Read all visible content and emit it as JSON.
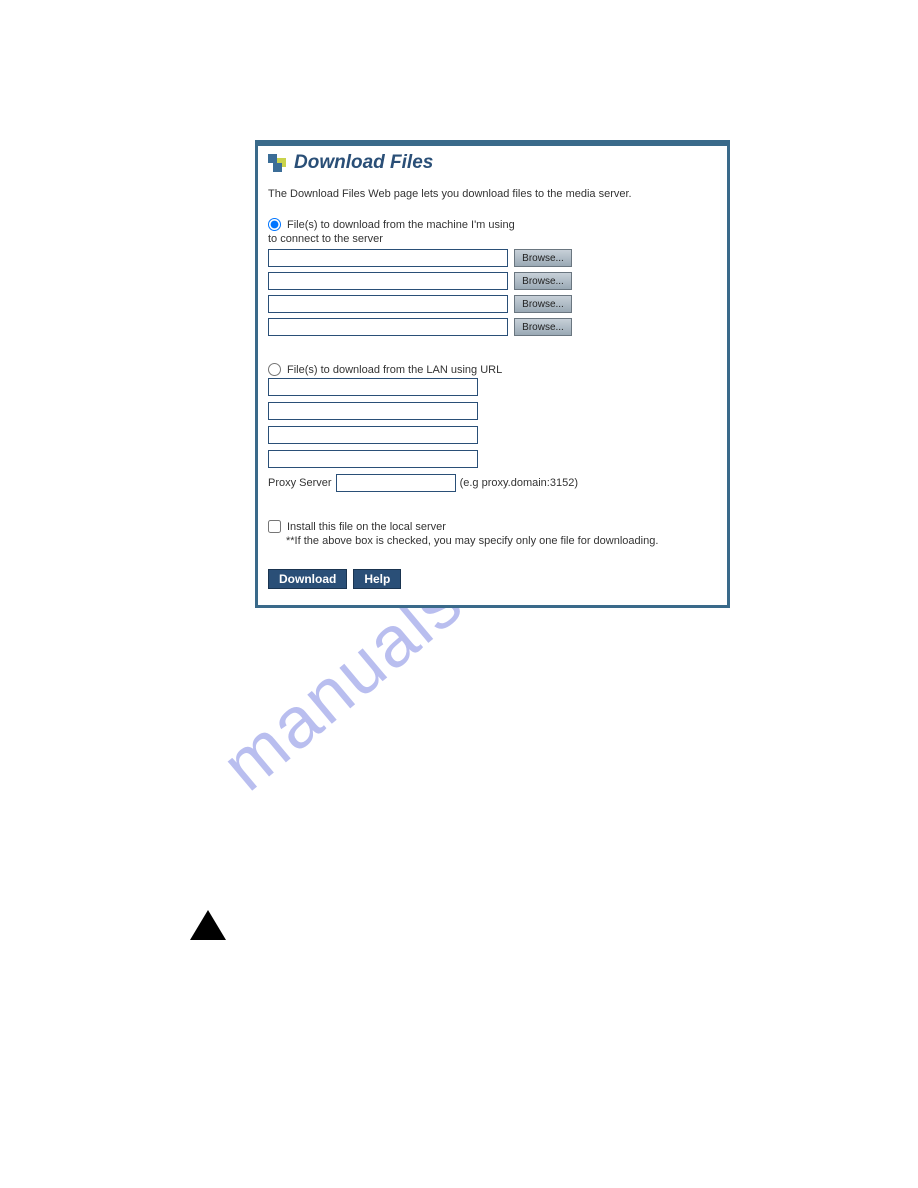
{
  "watermark": "manualshive.com",
  "dialog": {
    "title": "Download Files",
    "intro": "The Download Files Web page lets you download files to the media server.",
    "option_local": {
      "label": "File(s) to download from the machine I'm using",
      "sublabel": "to connect to the server",
      "browse_label": "Browse..."
    },
    "option_lan": {
      "label": "File(s) to download from the LAN using URL"
    },
    "proxy": {
      "label": "Proxy Server",
      "hint": "(e.g proxy.domain:3152)"
    },
    "install": {
      "label": "Install this file on the local server",
      "note": "**If the above box is checked, you may specify only one file for downloading."
    },
    "actions": {
      "download": "Download",
      "help": "Help"
    }
  }
}
